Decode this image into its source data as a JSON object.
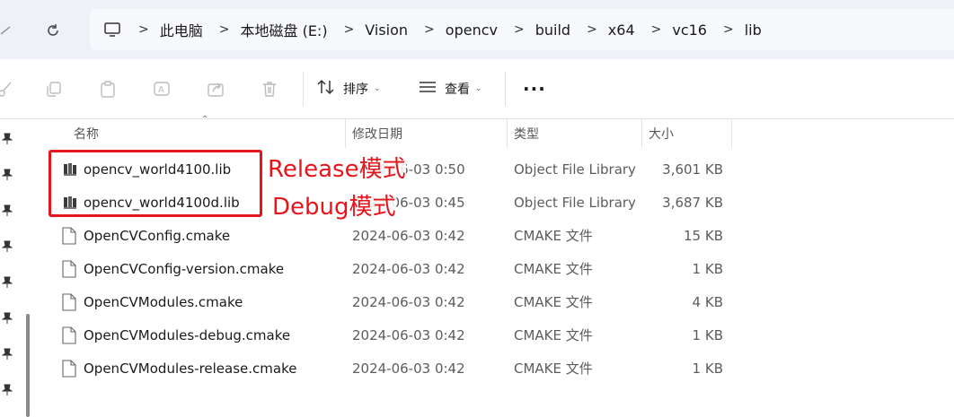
{
  "breadcrumb": {
    "items": [
      "此电脑",
      "本地磁盘 (E:)",
      "Vision",
      "opencv",
      "build",
      "x64",
      "vc16",
      "lib"
    ]
  },
  "toolbar": {
    "sort_label": "排序",
    "view_label": "查看",
    "more_label": "···"
  },
  "columns": {
    "name": "名称",
    "date": "修改日期",
    "type": "类型",
    "size": "大小"
  },
  "files": [
    {
      "name": "opencv_world4100.lib",
      "date": "2024-06-03 0:50",
      "type": "Object File Library",
      "size": "3,601 KB",
      "icon": "library-file-icon"
    },
    {
      "name": "opencv_world4100d.lib",
      "date": "2024-06-03 0:45",
      "type": "Object File Library",
      "size": "3,687 KB",
      "icon": "library-file-icon"
    },
    {
      "name": "OpenCVConfig.cmake",
      "date": "2024-06-03 0:42",
      "type": "CMAKE 文件",
      "size": "15 KB",
      "icon": "document-file-icon"
    },
    {
      "name": "OpenCVConfig-version.cmake",
      "date": "2024-06-03 0:42",
      "type": "CMAKE 文件",
      "size": "1 KB",
      "icon": "document-file-icon"
    },
    {
      "name": "OpenCVModules.cmake",
      "date": "2024-06-03 0:42",
      "type": "CMAKE 文件",
      "size": "4 KB",
      "icon": "document-file-icon"
    },
    {
      "name": "OpenCVModules-debug.cmake",
      "date": "2024-06-03 0:42",
      "type": "CMAKE 文件",
      "size": "1 KB",
      "icon": "document-file-icon"
    },
    {
      "name": "OpenCVModules-release.cmake",
      "date": "2024-06-03 0:42",
      "type": "CMAKE 文件",
      "size": "1 KB",
      "icon": "document-file-icon"
    }
  ],
  "annotations": {
    "release": "Release模式",
    "debug": "Debug模式",
    "color": "#e8141b"
  }
}
